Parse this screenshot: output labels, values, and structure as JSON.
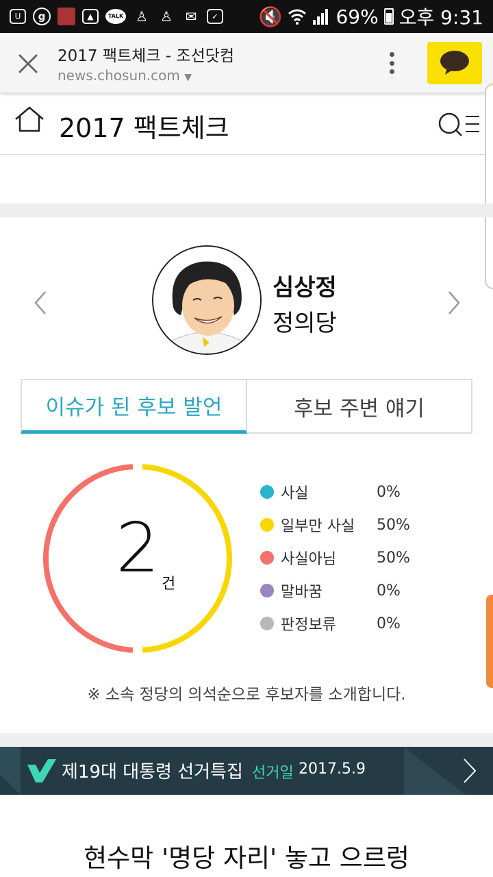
{
  "status_bar": {
    "battery": "69%",
    "time": "오후 9:31",
    "icons": [
      "ubox-icon",
      "g-icon",
      "game-icon",
      "gallery-icon",
      "talk-icon",
      "person-icon",
      "person-icon",
      "mail-icon",
      "clipboard-icon",
      "mute-icon",
      "wifi-icon",
      "signal-icon",
      "battery-icon"
    ]
  },
  "browser": {
    "title": "2017 팩트체크 - 조선닷컴",
    "url": "news.chosun.com",
    "kakao_color": "#f9e000"
  },
  "header": {
    "title": "2017 팩트체크"
  },
  "candidate": {
    "name": "심상정",
    "party": "정의당"
  },
  "tabs": [
    {
      "label": "이슈가 된 후보 발언",
      "active": true
    },
    {
      "label": "후보 주변 얘기",
      "active": false
    }
  ],
  "summary": {
    "count": "2",
    "unit": "건",
    "legend": [
      {
        "label": "사실",
        "value": "0%",
        "color": "#2bb3d0"
      },
      {
        "label": "일부만 사실",
        "value": "50%",
        "color": "#f9d600"
      },
      {
        "label": "사실아님",
        "value": "50%",
        "color": "#f4716a"
      },
      {
        "label": "말바꿈",
        "value": "0%",
        "color": "#9a86c0"
      },
      {
        "label": "판정보류",
        "value": "0%",
        "color": "#b5b9bd"
      }
    ]
  },
  "note": "※ 소속 정당의 의석순으로 후보자를 소개합니다.",
  "banner": {
    "title": "제19대 대통령 선거특집",
    "sub_label": "선거일",
    "date": "2017.5.9"
  },
  "headline": "현수막 '명당 자리' 놓고 으르렁"
}
